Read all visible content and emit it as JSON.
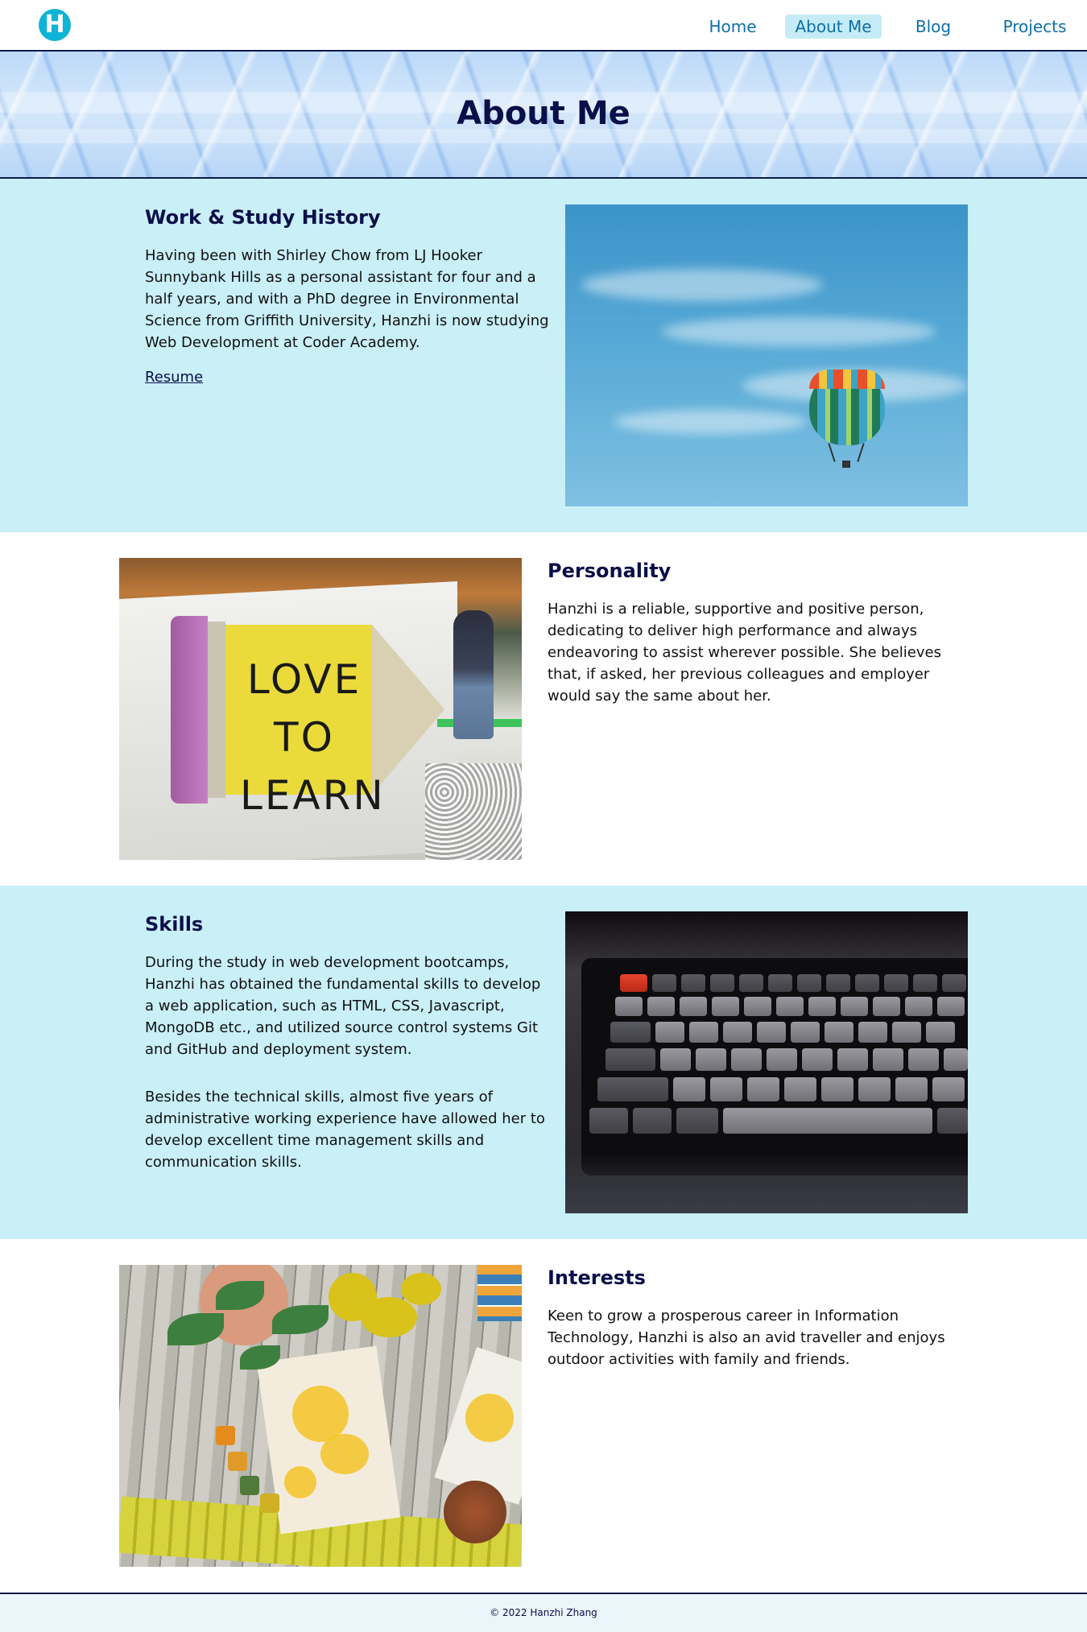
{
  "header": {
    "logo_letter": "H",
    "nav": [
      {
        "label": "Home"
      },
      {
        "label": "About Me"
      },
      {
        "label": "Blog"
      },
      {
        "label": "Projects"
      }
    ],
    "active_nav": "About Me"
  },
  "hero": {
    "title": "About Me"
  },
  "sections": {
    "work": {
      "title": "Work & Study History",
      "text": "Having been with Shirley Chow from LJ Hooker Sunnybank Hills as a personal assistant for four and a half years, and with a PhD degree in Environmental Science from Griffith University, Hanzhi is now studying Web Development at Coder Academy.",
      "link": "Resume"
    },
    "personality": {
      "title": "Personality",
      "text": "Hanzhi is a reliable, supportive and positive person, dedicating to deliver high performance and always endeavoring to assist wherever possible. She believes that, if asked, her previous colleagues and employer would say the same about her."
    },
    "skills": {
      "title": "Skills",
      "text1": "During the study in web development bootcamps, Hanzhi has obtained the fundamental skills to develop a web application, such as HTML, CSS, Javascript, MongoDB etc., and utilized source control systems Git and GitHub and deployment system.",
      "text2": "Besides the technical skills, almost five years of administrative working experience have allowed her to develop excellent time management skills and communication skills."
    },
    "interests": {
      "title": "Interests",
      "text": "Keen to grow a prosperous career in Information Technology, Hanzhi is also an avid traveller and enjoys outdoor activities with family and friends."
    }
  },
  "photos": {
    "pencil_sign_text": "LOVE TO LEARN"
  },
  "footer": {
    "copyright": "© 2022 Hanzhi Zhang"
  },
  "colors": {
    "navy": "#0a0f4a",
    "nav_link": "#0d6fa8",
    "nav_active_bg": "#c5ecf6",
    "section_tint": "#c9eff7",
    "logo": "#0fb3d6",
    "footer_bg": "#e9f7fb"
  }
}
